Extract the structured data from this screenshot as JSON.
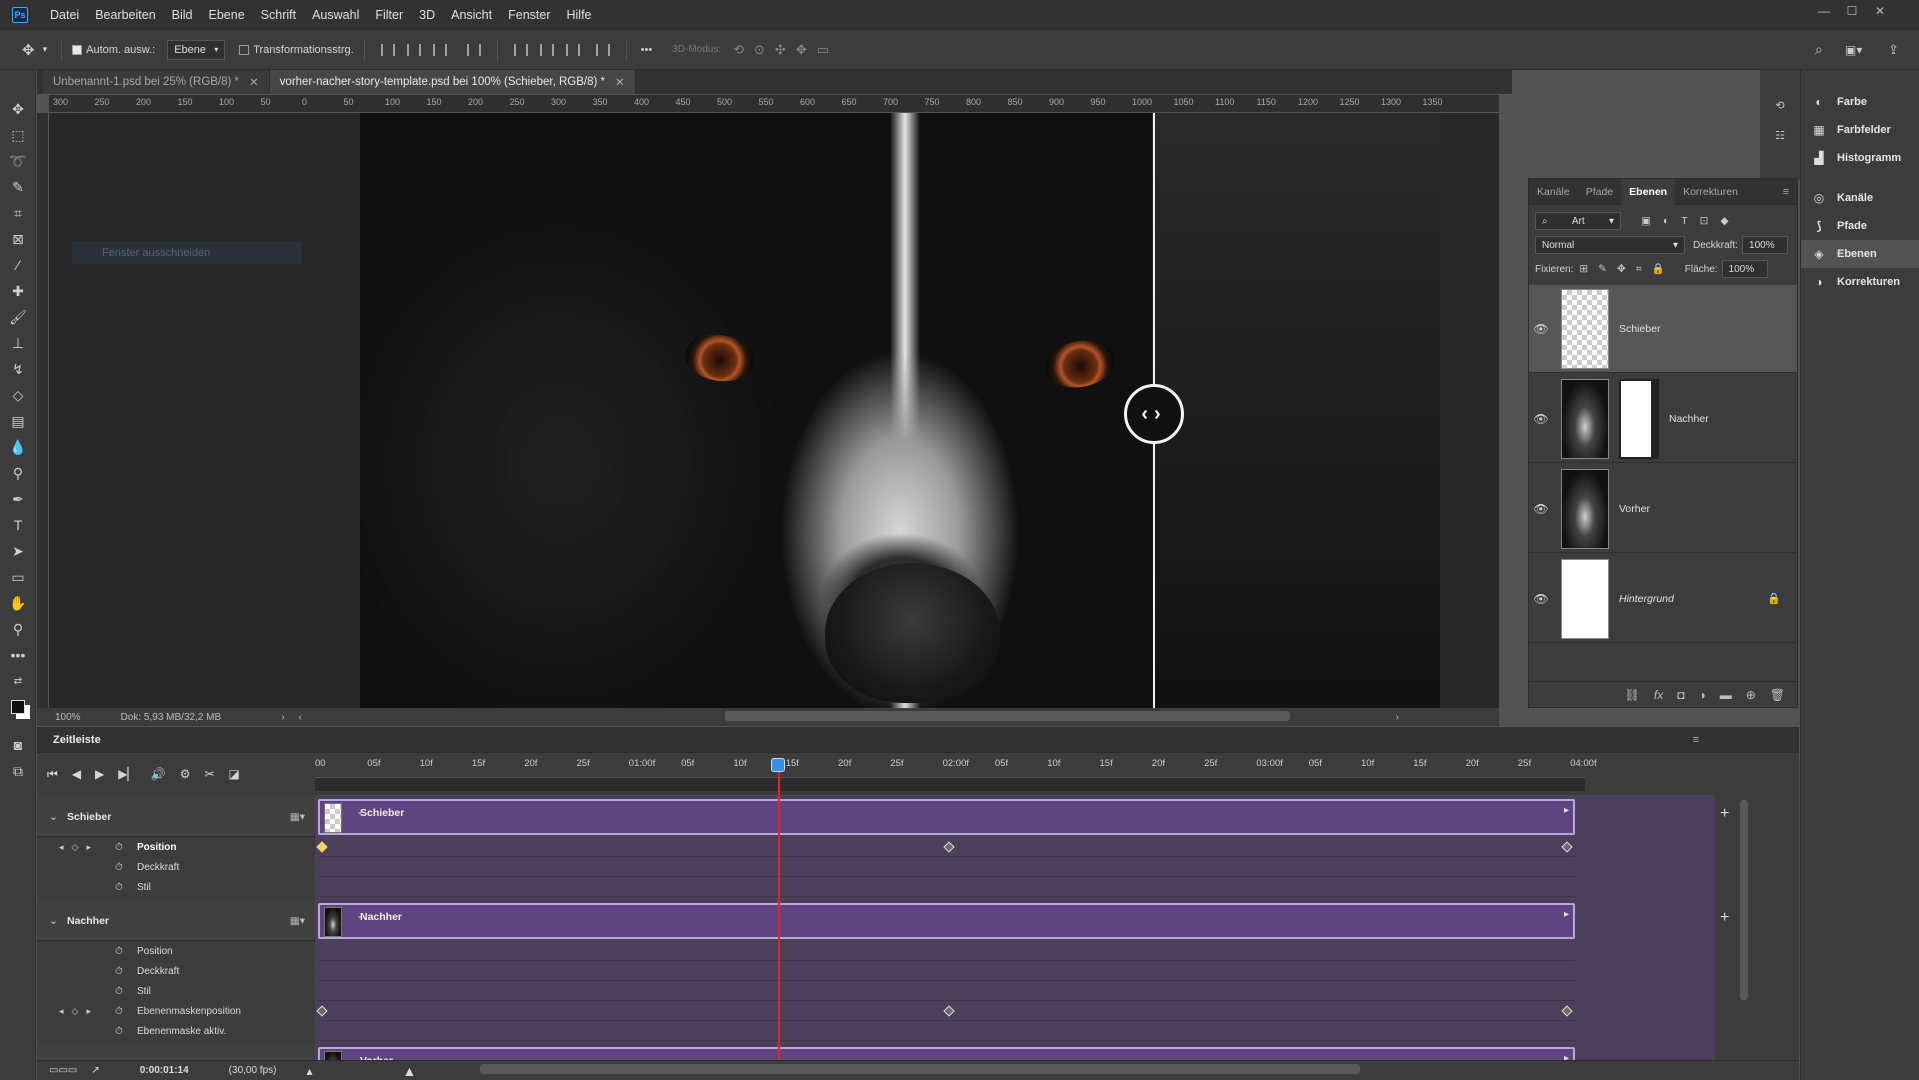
{
  "menubar": {
    "logo": "Ps",
    "items": [
      "Datei",
      "Bearbeiten",
      "Bild",
      "Ebene",
      "Schrift",
      "Auswahl",
      "Filter",
      "3D",
      "Ansicht",
      "Fenster",
      "Hilfe"
    ]
  },
  "options": {
    "auto_select_label": "Autom. ausw.:",
    "auto_select_checked": true,
    "auto_select_target": "Ebene",
    "transform_label": "Transformationsstrg.",
    "transform_checked": false,
    "more": "•••",
    "mode_3d_label": "3D-Modus:"
  },
  "tabs": [
    {
      "label": "Unbenannt-1.psd bei 25% (RGB/8) *",
      "active": false
    },
    {
      "label": "vorher-nacher-story-template.psd bei 100% (Schieber, RGB/8) *",
      "active": true
    }
  ],
  "ruler_h": [
    "300",
    "250",
    "200",
    "150",
    "100",
    "50",
    "0",
    "50",
    "100",
    "150",
    "200",
    "250",
    "300",
    "350",
    "400",
    "450",
    "500",
    "550",
    "600",
    "650",
    "700",
    "750",
    "800",
    "850",
    "900",
    "950",
    "1000",
    "1050",
    "1100",
    "1150",
    "1200",
    "1250",
    "1300",
    "1350"
  ],
  "ghost_panel": "Fenster ausschneiden",
  "status": {
    "zoom": "100%",
    "doc": "Dok: 5,93 MB/32,2 MB"
  },
  "dock": [
    {
      "label": "Farbe",
      "icon": "palette-icon",
      "glyph": "◐"
    },
    {
      "label": "Farbfelder",
      "icon": "swatches-icon",
      "glyph": "▦"
    },
    {
      "label": "Histogramm",
      "icon": "histogram-icon",
      "glyph": "▟"
    },
    {
      "label": "Kanäle",
      "icon": "channels-icon",
      "glyph": "◎"
    },
    {
      "label": "Pfade",
      "icon": "paths-icon",
      "glyph": "⟆"
    },
    {
      "label": "Ebenen",
      "icon": "layers-icon",
      "glyph": "◈"
    },
    {
      "label": "Korrekturen",
      "icon": "adjustments-icon",
      "glyph": "◑"
    }
  ],
  "layers_panel": {
    "tabs": [
      "Kanäle",
      "Pfade",
      "Ebenen",
      "Korrekturen"
    ],
    "active_tab": "Ebenen",
    "filter_label": "Art",
    "blend_mode": "Normal",
    "opacity_label": "Deckkraft:",
    "opacity_value": "100%",
    "lock_label": "Fixieren:",
    "fill_label": "Fläche:",
    "fill_value": "100%",
    "layers": [
      {
        "name": "Schieber",
        "selected": true,
        "thumb": "checker",
        "mask": false,
        "italic": false,
        "locked": false
      },
      {
        "name": "Nachher",
        "selected": false,
        "thumb": "dog",
        "mask": true,
        "italic": false,
        "locked": false
      },
      {
        "name": "Vorher",
        "selected": false,
        "thumb": "dog",
        "mask": false,
        "italic": false,
        "locked": false
      },
      {
        "name": "Hintergrund",
        "selected": false,
        "thumb": "white",
        "mask": false,
        "italic": true,
        "locked": true
      }
    ]
  },
  "timeline": {
    "title": "Zeitleiste",
    "ticks": [
      "00",
      "05f",
      "10f",
      "15f",
      "20f",
      "25f",
      "01:00f",
      "05f",
      "10f",
      "15f",
      "20f",
      "25f",
      "02:00f",
      "05f",
      "10f",
      "15f",
      "20f",
      "25f",
      "03:00f",
      "05f",
      "10f",
      "15f",
      "20f",
      "25f",
      "04:00f"
    ],
    "tracks": [
      {
        "name": "Schieber",
        "bar_label": "Schieber",
        "props": [
          "Position",
          "Deckkraft",
          "Stil"
        ]
      },
      {
        "name": "Nachher",
        "bar_label": "Nachher",
        "props": [
          "Position",
          "Deckkraft",
          "Stil",
          "Ebenenmaskenposition",
          "Ebenenmaske aktiv."
        ]
      },
      {
        "name": "Vorher",
        "bar_label": "Vorher",
        "props": []
      }
    ],
    "current_time": "0:00:01:14",
    "fps": "(30,00 fps)"
  }
}
